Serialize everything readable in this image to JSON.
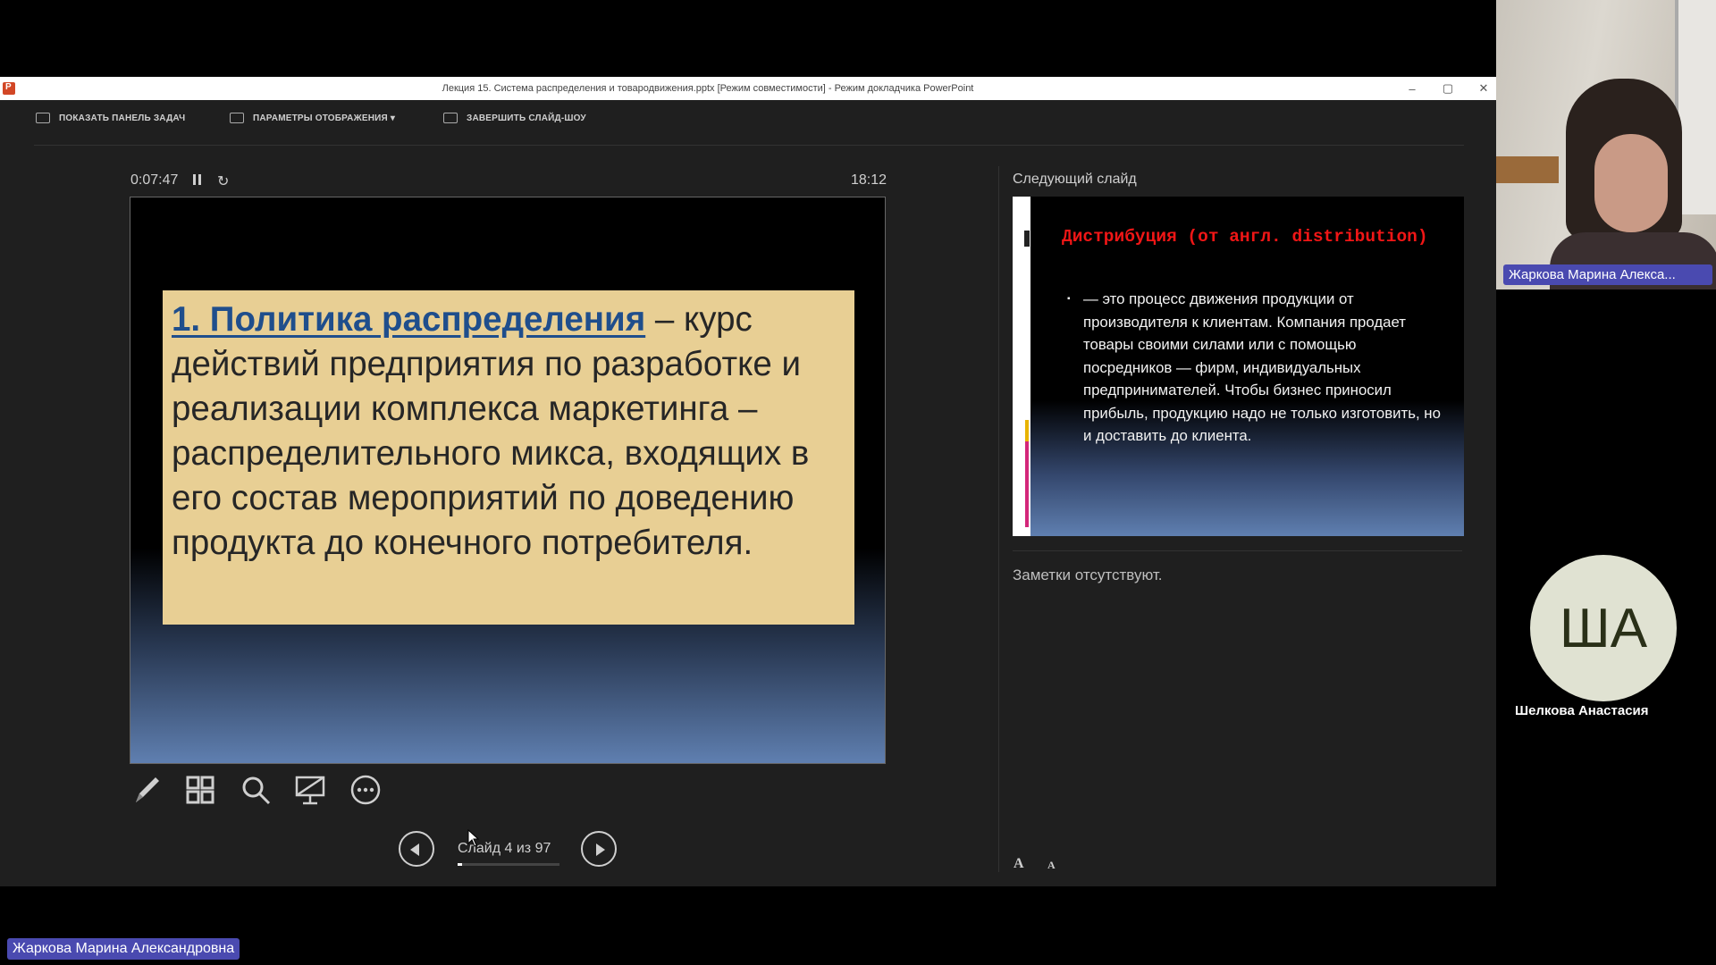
{
  "window": {
    "title": "Лекция 15. Система распределения и товародвижения.pptx [Режим совместимости] - Режим докладчика PowerPoint",
    "minimize": "–",
    "maximize": "▢",
    "close": "✕"
  },
  "toolbar": {
    "show_taskbar": "ПОКАЗАТЬ ПАНЕЛЬ ЗАДАЧ",
    "display_settings": "ПАРАМЕТРЫ ОТОБРАЖЕНИЯ ▾",
    "end_show": "ЗАВЕРШИТЬ СЛАЙД-ШОУ"
  },
  "timer": {
    "elapsed": "0:07:47",
    "reset_icon": "↻",
    "clock": "18:12"
  },
  "current_slide": {
    "heading": "1. Политика распределения",
    "body": " – курс действий предприятия по разработке и реализации комплекса маркетинга – распределительного микса, входящих в его состав мероприятий по доведению продукта до конечного потребителя."
  },
  "tools": {
    "pen": "pen-icon",
    "grid": "grid-icon",
    "zoom": "zoom-icon",
    "screen": "screen-icon",
    "more": "more-icon"
  },
  "navigation": {
    "counter": "Слайд 4 из 97",
    "progress": 0.04
  },
  "next_slide": {
    "label": "Следующий слайд",
    "title": "Дистрибуция (от англ. distribution)",
    "bullet": "— это процесс движения продукции от производителя к клиентам. Компания продает товары своими силами или с помощью посредников — фирм, индивидуальных предпринимателей. Чтобы бизнес приносил прибыль, продукцию надо не только изготовить, но и доставить до клиента."
  },
  "notes": {
    "text": "Заметки отсутствуют.",
    "font_up": "A",
    "font_down": "A"
  },
  "call": {
    "video_name": "Жаркова Марина Алекса...",
    "avatar_initials": "ША",
    "avatar_name": "Шелкова Анастасия",
    "bottom_name": "Жаркова Марина Александровна"
  }
}
